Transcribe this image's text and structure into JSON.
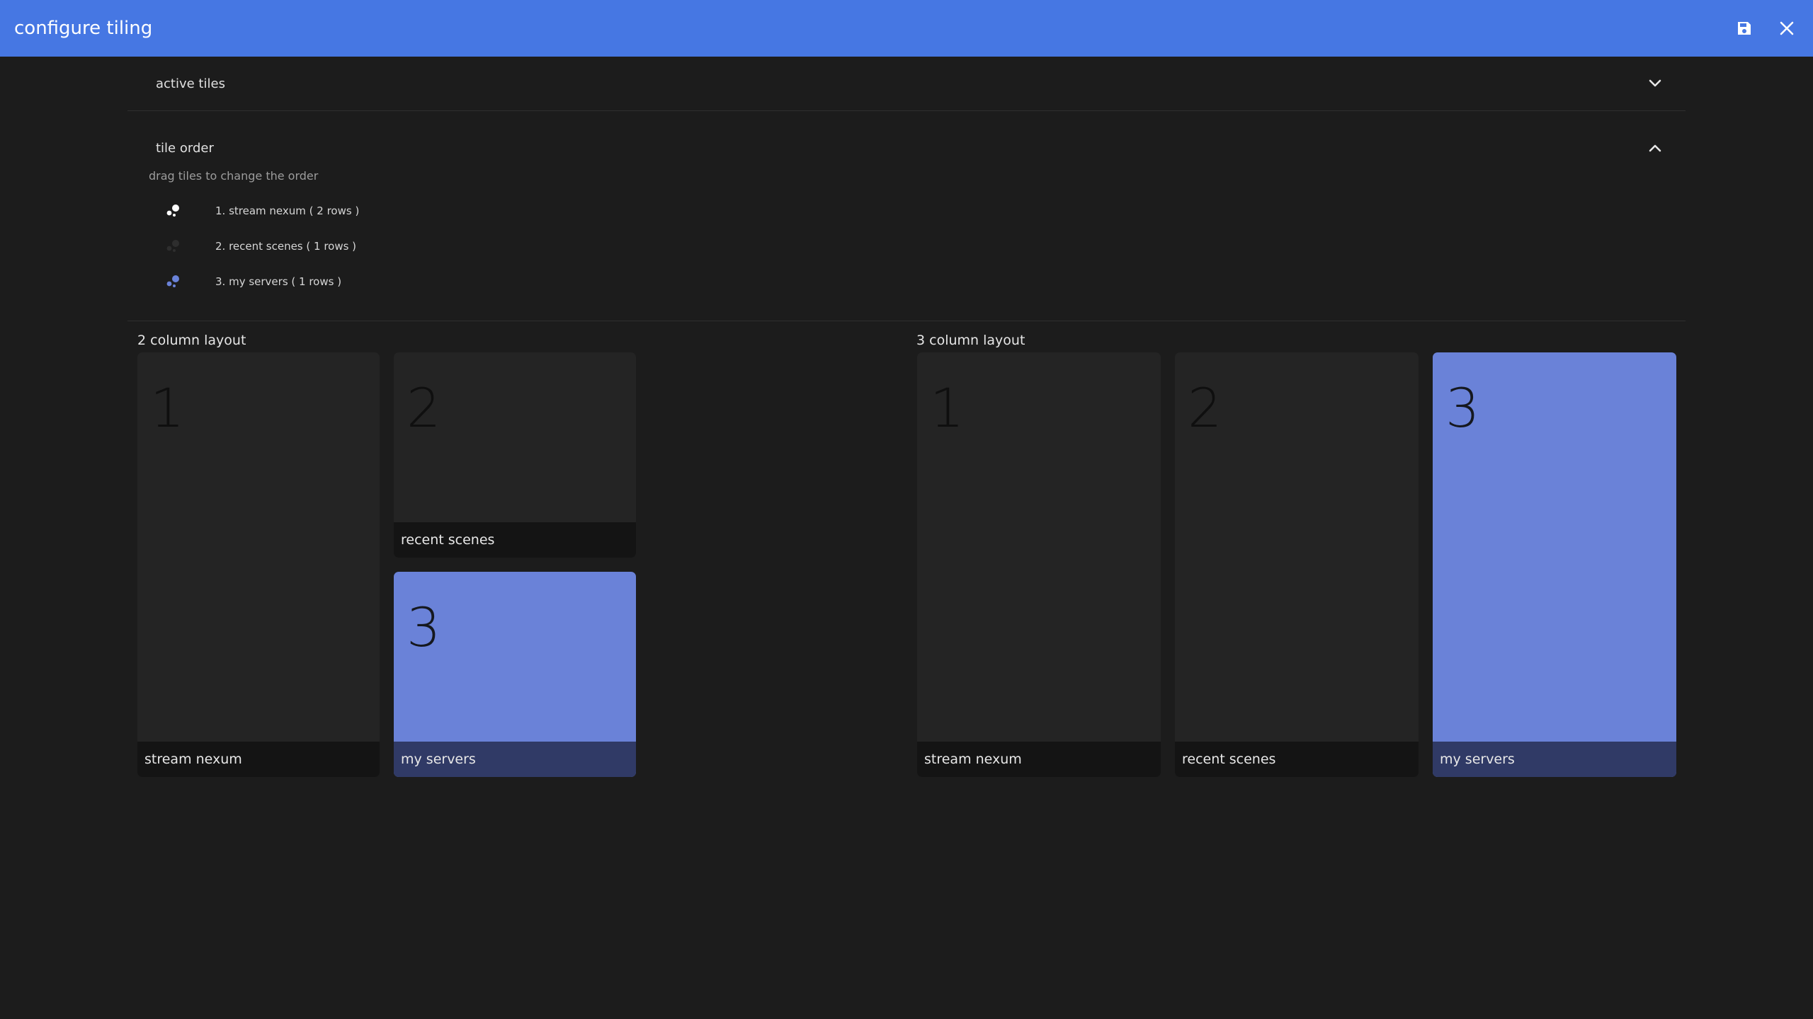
{
  "header": {
    "title": "configure tiling",
    "save_icon": "save-icon",
    "close_icon": "close-icon",
    "accent_color": "#4677e3"
  },
  "sections": {
    "active_tiles": {
      "label": "active tiles",
      "expanded": false
    },
    "tile_order": {
      "label": "tile order",
      "expanded": true,
      "hint": "drag tiles to change the order",
      "items": [
        {
          "label": "1. stream nexum ( 2 rows )",
          "handle_color": "#ffffff"
        },
        {
          "label": "2. recent scenes ( 1 rows )",
          "handle_color": "#2e2e2e"
        },
        {
          "label": "3. my servers ( 1 rows )",
          "handle_color": "#6a82d8"
        }
      ]
    }
  },
  "layouts": {
    "two_column": {
      "label": "2 column layout",
      "tiles": [
        {
          "number": "1",
          "name": "stream nexum",
          "color": "#242424"
        },
        {
          "number": "2",
          "name": "recent scenes",
          "color": "#242424"
        },
        {
          "number": "3",
          "name": "my servers",
          "color": "#6a82d8"
        }
      ]
    },
    "three_column": {
      "label": "3 column layout",
      "tiles": [
        {
          "number": "1",
          "name": "stream nexum",
          "color": "#242424"
        },
        {
          "number": "2",
          "name": "recent scenes",
          "color": "#242424"
        },
        {
          "number": "3",
          "name": "my servers",
          "color": "#6a82d8"
        }
      ]
    }
  }
}
